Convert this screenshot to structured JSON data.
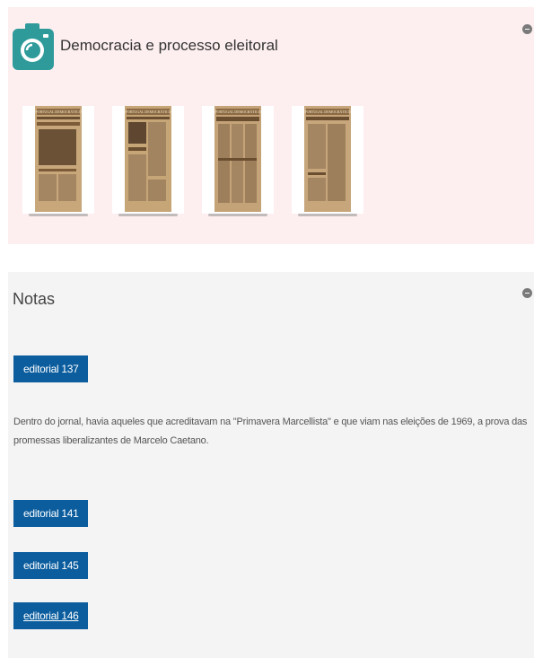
{
  "gallery": {
    "title": "Democracia e processo eleitoral",
    "icon": "camera-icon",
    "accent_color": "#2e9b9a",
    "thumbnails": [
      {
        "masthead": "PORTUGAL DEMOCRÁTICO"
      },
      {
        "masthead": "PORTUGAL DEMOCRÁTICO"
      },
      {
        "masthead": "PORTUGAL DEMOCRÁTICO"
      },
      {
        "masthead": "PORTUGAL DEMOCRÁTICO"
      }
    ]
  },
  "notes": {
    "title": "Notas",
    "button_color": "#0b5d9e",
    "buttons": [
      "editorial 137",
      "editorial 141",
      "editorial 145",
      "editorial 146"
    ],
    "paragraph": "Dentro do jornal, havia aqueles que acreditavam na \"Primavera Marcellista\" e que viam nas eleições de 1969, a prova das promessas liberalizantes de Marcelo Caetano."
  }
}
